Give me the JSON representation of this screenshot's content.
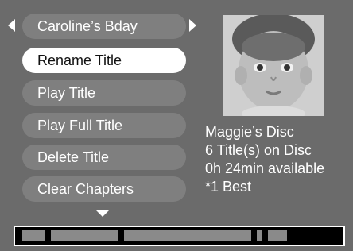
{
  "title_selector": {
    "current": "Caroline’s Bday",
    "prev_icon": "left-triangle-icon",
    "next_icon": "right-triangle-icon"
  },
  "menu": {
    "items": [
      {
        "label": "Rename Title",
        "selected": true
      },
      {
        "label": "Play Title",
        "selected": false
      },
      {
        "label": "Play Full Title",
        "selected": false
      },
      {
        "label": "Delete Title",
        "selected": false
      },
      {
        "label": "Clear Chapters",
        "selected": false
      }
    ],
    "more_icon": "down-triangle-icon"
  },
  "disc_info": {
    "name": "Maggie’s Disc",
    "titles": "6 Title(s) on Disc",
    "available": "0h 24min available",
    "quality": "*1 Best"
  },
  "thumbnail": {
    "description_icon": "baby-photo"
  },
  "colors": {
    "background": "#6b6b6b",
    "button": "#7f7f7f",
    "selected_button": "#ffffff",
    "selected_text": "#111111",
    "timeline_segment": "#8a8a8a"
  }
}
